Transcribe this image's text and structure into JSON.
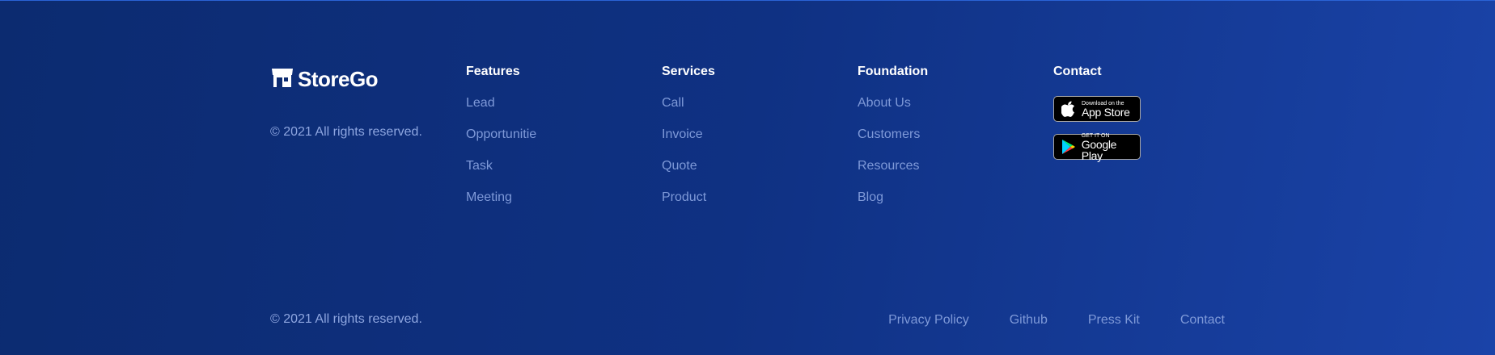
{
  "brand": {
    "name": "StoreGo",
    "icon": "store-icon"
  },
  "copyright_top": "© 2021 All rights reserved.",
  "copyright_bottom": "© 2021 All rights reserved.",
  "columns": [
    {
      "title": "Features",
      "links": [
        "Lead",
        "Opportunitie",
        "Task",
        "Meeting"
      ]
    },
    {
      "title": "Services",
      "links": [
        "Call",
        "Invoice",
        "Quote",
        "Product"
      ]
    },
    {
      "title": "Foundation",
      "links": [
        "About Us",
        "Customers",
        "Resources",
        "Blog"
      ]
    }
  ],
  "contact": {
    "title": "Contact",
    "app_store": {
      "small": "Download on the",
      "big": "App Store",
      "icon": "apple-icon"
    },
    "google_play": {
      "small": "GET IT ON",
      "big": "Google Play",
      "icon": "google-play-icon"
    }
  },
  "bottom_links": [
    "Privacy Policy",
    "Github",
    "Press Kit",
    "Contact"
  ]
}
